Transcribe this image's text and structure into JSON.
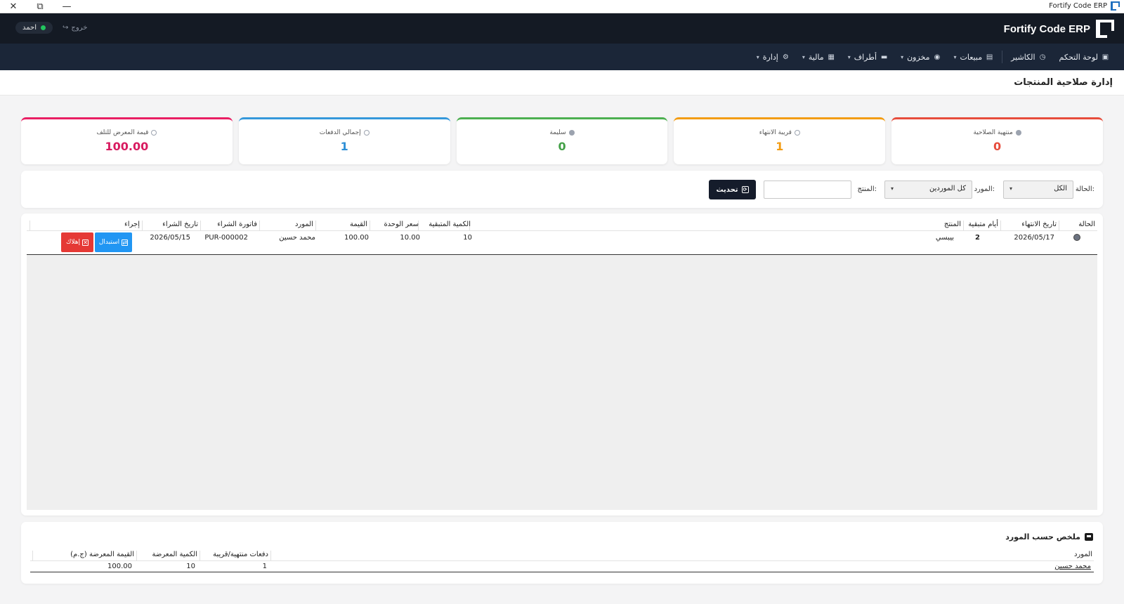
{
  "window": {
    "title": "Fortify Code ERP"
  },
  "header": {
    "brand": "Fortify Code ERP",
    "user_name": "احمد",
    "logout_label": "خروج"
  },
  "nav": {
    "items": [
      {
        "label": "لوحة التحكم",
        "icon": "dashboard-icon",
        "caret": false
      },
      {
        "label": "الكاشير",
        "icon": "cashier-icon",
        "caret": false
      },
      {
        "label": "مبيعات",
        "icon": "sales-icon",
        "caret": true
      },
      {
        "label": "مخزون",
        "icon": "inventory-icon",
        "caret": true
      },
      {
        "label": "أطراف",
        "icon": "parties-icon",
        "caret": true
      },
      {
        "label": "مالية",
        "icon": "finance-icon",
        "caret": true
      },
      {
        "label": "إدارة",
        "icon": "admin-icon",
        "caret": true
      }
    ]
  },
  "page": {
    "title": "إدارة صلاحية المنتجات"
  },
  "cards": [
    {
      "label": "منتهية الصلاحية",
      "value": "0",
      "color": "#e74c3c",
      "border": "#e74c3c",
      "icon": "expired-icon"
    },
    {
      "label": "قريبة الانتهاء",
      "value": "1",
      "color": "#f39c12",
      "border": "#f39c12",
      "icon": "near-expiry-icon"
    },
    {
      "label": "سليمة",
      "value": "0",
      "color": "#43a047",
      "border": "#4caf50",
      "icon": "valid-icon"
    },
    {
      "label": "إجمالي الدفعات",
      "value": "1",
      "color": "#2d8fd6",
      "border": "#3498db",
      "icon": "batches-icon"
    },
    {
      "label": "قيمة المعرض للتلف",
      "value": "100.00",
      "color": "#d81b60",
      "border": "#e91e63",
      "icon": "value-at-risk-icon"
    }
  ],
  "filters": {
    "status_label": "الحالة:",
    "status_value": "الكل",
    "supplier_label": "المورد:",
    "supplier_value": "كل الموردين",
    "product_label": "المنتج:",
    "product_value": "",
    "refresh_label": "تحديث"
  },
  "table": {
    "columns": [
      "الحالة",
      "تاريخ الانتهاء",
      "أيام متبقية",
      "المنتج",
      "الكمية المتبقية",
      "سعر الوحدة",
      "القيمة",
      "المورد",
      "فاتورة الشراء",
      "تاريخ الشراء",
      "إجراء"
    ],
    "rows": [
      {
        "status": "near-expiry",
        "expiry_date": "2026/05/17",
        "days_left": "2",
        "product": "بيبسي",
        "qty_left": "10",
        "unit_price": "10.00",
        "value": "100.00",
        "supplier": "محمد حسين",
        "invoice": "PUR-000002",
        "purchase_date": "2026/05/15",
        "replace_label": "استبدال",
        "dispose_label": "إهلاك"
      }
    ]
  },
  "summary": {
    "title": "ملخص حسب المورد",
    "columns": [
      "المورد",
      "دفعات منتهية/قريبة",
      "الكمية المعرضة",
      "القيمة المعرضة (ج.م)"
    ],
    "rows": [
      {
        "supplier": "محمد حسين",
        "batches": "1",
        "qty": "10",
        "value": "100.00"
      }
    ]
  }
}
